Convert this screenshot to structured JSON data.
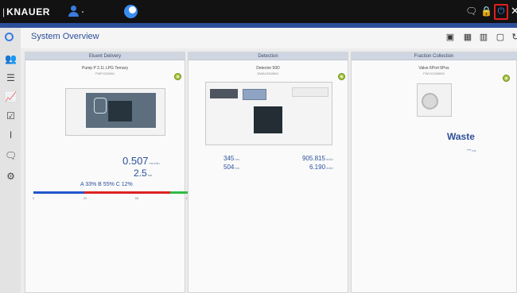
{
  "brand": {
    "mark": "|",
    "name": "KNAUER"
  },
  "page": {
    "title": "System Overview"
  },
  "panels": {
    "eluent": {
      "header": "Eluent Delivery",
      "device_name": "Pump P 2.1L LPG Ternary",
      "serial": "FWF1234561",
      "flow_value": "0.507",
      "flow_unit": "mL/min",
      "pressure_value": "2.5",
      "pressure_unit": "bar",
      "composition": "A 33% B 55% C 12%",
      "bar": {
        "fractions": [
          0.33,
          0.55,
          0.12
        ],
        "colors": [
          "#2255cc",
          "#dd2222",
          "#33bb44"
        ]
      },
      "scale_ticks": [
        "0",
        "33",
        "66",
        "100"
      ]
    },
    "detection": {
      "header": "Detection",
      "device_name": "Detector 50D",
      "serial": "DWA12345601",
      "wavelength_1": "345",
      "wavelength_2": "504",
      "wl_unit": "nm",
      "signal_1": "905.815",
      "signal_2": "6.190",
      "signal_unit": "mAU"
    },
    "fraction": {
      "header": "Fraction Collection",
      "device_name": "Valve 6Port 6Pos",
      "serial": "FWV12345600",
      "position_label": "Waste",
      "volume_value": "--",
      "volume_unit": "mL"
    }
  },
  "colors": {
    "accent": "#2c4f9a",
    "status_green": "#a8c840",
    "power_highlight": "#e01f1f"
  },
  "icons": {
    "topbar": [
      "user-icon",
      "logo-icon",
      "chat-icon",
      "lock-icon",
      "power-icon",
      "close-icon"
    ],
    "sidebar": [
      "users-icon",
      "list-icon",
      "chart-icon",
      "checkbox-icon",
      "cursor-icon",
      "chat-icon",
      "gear-icon"
    ],
    "views": [
      "grid-view-icon",
      "tile-view-icon",
      "column-view-icon",
      "single-view-icon",
      "refresh-icon"
    ]
  },
  "glyphs": {
    "chat": "🗨",
    "lock": "🔒",
    "power": "⏻",
    "close": "✕",
    "users": "👥",
    "list": "☰",
    "chart": "📈",
    "checkbox": "☑",
    "cursor": "I",
    "chat_side": "🗨",
    "gear": "⚙",
    "grid_view": "▣",
    "tile_view": "▦",
    "column_view": "▥",
    "single_view": "▢",
    "refresh": "↻"
  }
}
